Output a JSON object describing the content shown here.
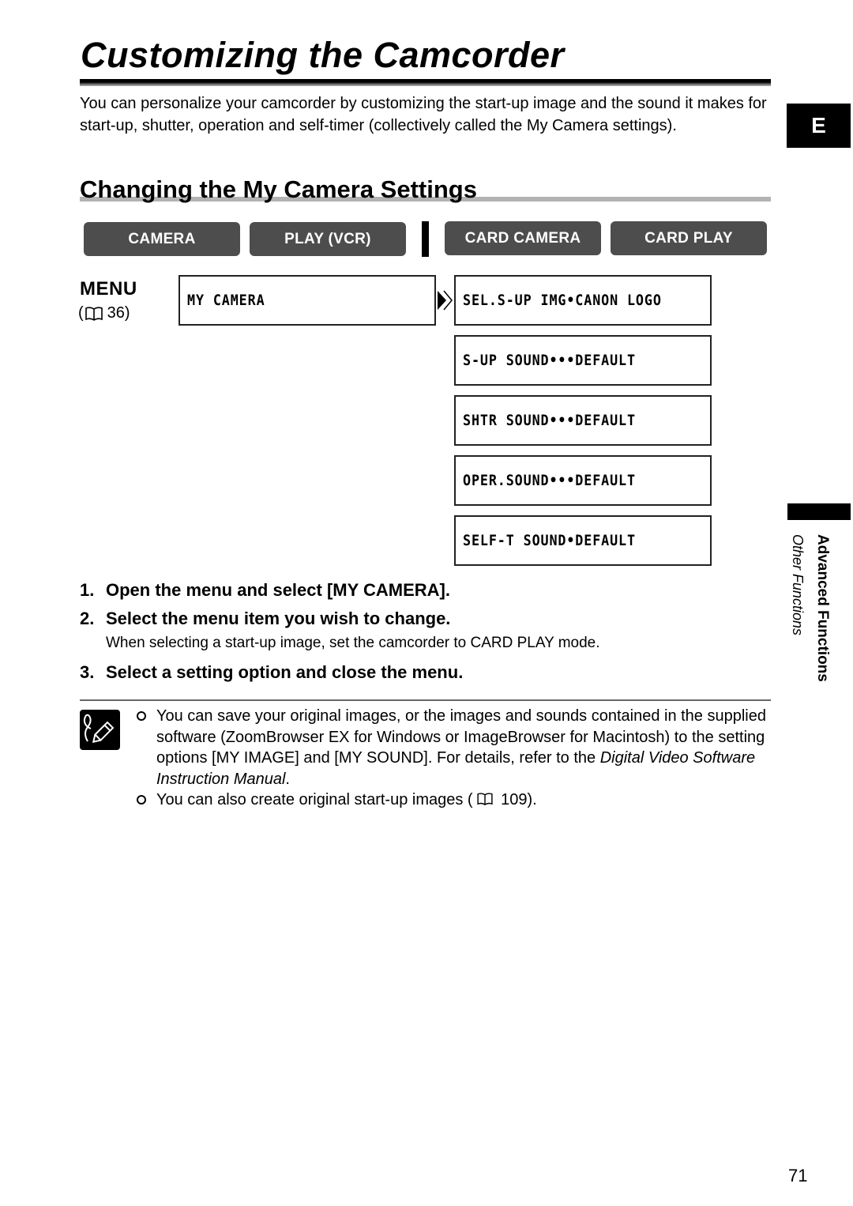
{
  "page": {
    "title": "Customizing the Camcorder",
    "intro": "You can personalize your camcorder by customizing the start-up image and the sound it makes for start-up, shutter, operation and self-timer (collectively called the My Camera settings).",
    "language_tab": "E",
    "page_number": "71"
  },
  "section": {
    "heading": "Changing the My Camera Settings"
  },
  "modes": {
    "buttons": [
      {
        "label": "CAMERA"
      },
      {
        "label": "PLAY (VCR)"
      },
      {
        "label": "CARD CAMERA"
      },
      {
        "label": "CARD PLAY"
      }
    ],
    "button_color": "#4d4d4d"
  },
  "menu": {
    "label": "MENU",
    "ref_open": "(",
    "ref_page": "36)",
    "main_item": "MY CAMERA",
    "options": [
      {
        "text": "SEL.S-UP IMG•CANON LOGO"
      },
      {
        "text": "S-UP SOUND•••DEFAULT"
      },
      {
        "text": "SHTR SOUND•••DEFAULT"
      },
      {
        "text": "OPER.SOUND•••DEFAULT"
      },
      {
        "text": "SELF-T SOUND•DEFAULT"
      }
    ]
  },
  "steps": [
    {
      "num": "1.",
      "text": "Open the menu and select [MY CAMERA]."
    },
    {
      "num": "2.",
      "text": "Select the menu item you wish to change.",
      "note": "When selecting a start-up image, set the camcorder to CARD PLAY mode."
    },
    {
      "num": "3.",
      "text": "Select a setting option and close the menu."
    }
  ],
  "notes": {
    "icon": "pencil-note-icon",
    "item1_prefix": "You can save your original images, or the images and sounds contained in the supplied software (ZoomBrowser EX for Windows or ImageBrowser for Macintosh) to the setting options [MY IMAGE] and [MY SOUND]. For details, refer to the ",
    "item1_italic": "Digital Video Software Instruction Manual",
    "item1_suffix": ".",
    "item2_prefix": "You can also create original start-up images (",
    "item2_suffix": " 109)."
  },
  "sidebar": {
    "primary": "Advanced Functions",
    "secondary": "Other Functions"
  }
}
